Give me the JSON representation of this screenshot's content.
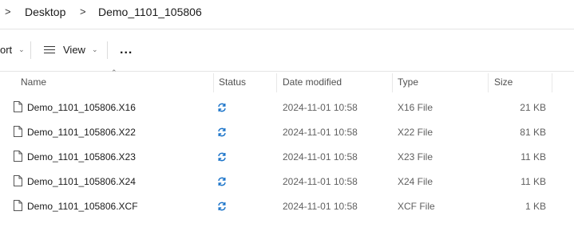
{
  "breadcrumb": {
    "items": [
      "Desktop",
      "Demo_1101_105806"
    ],
    "separator": ">"
  },
  "toolbar": {
    "sort_label": "ort",
    "view_label": "View",
    "more_label": "..."
  },
  "columns": {
    "name": "Name",
    "status": "Status",
    "date_modified": "Date modified",
    "type": "Type",
    "size": "Size"
  },
  "colors": {
    "sync_blue": "#1a73c9",
    "date_text": "#606060"
  },
  "status_icon": "sync-icon",
  "files": [
    {
      "name": "Demo_1101_105806.X16",
      "date": "2024-11-01 10:58",
      "type": "X16 File",
      "size": "21 KB"
    },
    {
      "name": "Demo_1101_105806.X22",
      "date": "2024-11-01 10:58",
      "type": "X22 File",
      "size": "81 KB"
    },
    {
      "name": "Demo_1101_105806.X23",
      "date": "2024-11-01 10:58",
      "type": "X23 File",
      "size": "11 KB"
    },
    {
      "name": "Demo_1101_105806.X24",
      "date": "2024-11-01 10:58",
      "type": "X24 File",
      "size": "11 KB"
    },
    {
      "name": "Demo_1101_105806.XCF",
      "date": "2024-11-01 10:58",
      "type": "XCF File",
      "size": "1 KB"
    }
  ]
}
